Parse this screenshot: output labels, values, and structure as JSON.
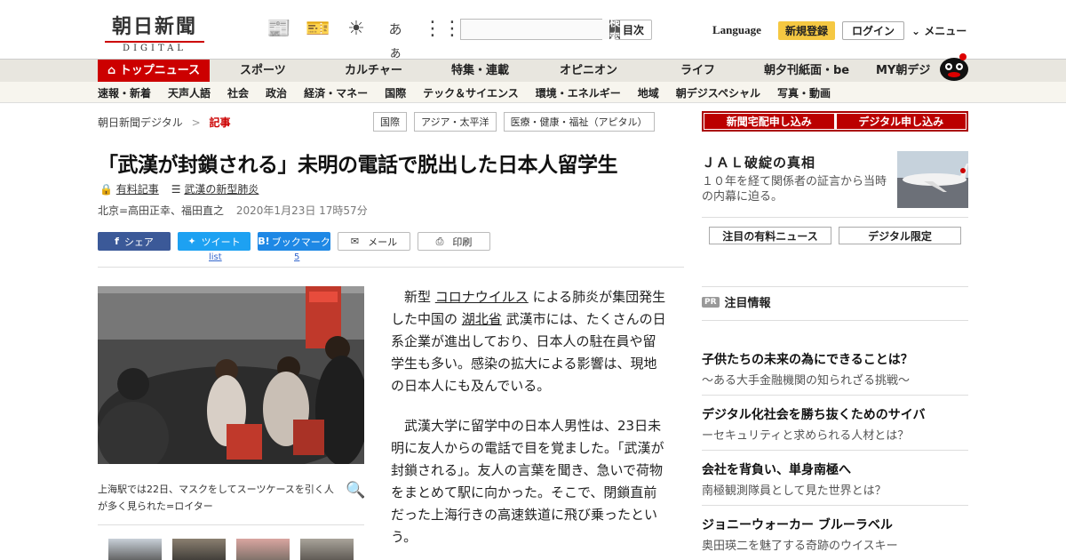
{
  "header": {
    "logo_jp": "朝日新聞",
    "logo_en": "DIGITAL",
    "search_button": "検索",
    "mokuji": "目次",
    "language": "Language",
    "register": "新規登録",
    "login": "ログイン",
    "menu": "メニュー"
  },
  "nav1": [
    "トップニュース",
    "スポーツ",
    "カルチャー",
    "特集・連載",
    "オピニオン",
    "ライフ",
    "朝夕刊紙面・be",
    "MY朝デジ"
  ],
  "nav2": [
    "速報・新着",
    "天声人語",
    "社会",
    "政治",
    "経済・マネー",
    "国際",
    "テック＆サイエンス",
    "環境・エネルギー",
    "地域",
    "朝デジスペシャル",
    "写真・動画"
  ],
  "breadcrumb": {
    "home": "朝日新聞デジタル",
    "sep": ">",
    "current": "記事"
  },
  "tags": [
    "国際",
    "アジア・太平洋",
    "医療・健康・福祉（アピタル）"
  ],
  "article": {
    "headline": "「武漢が封鎖される」未明の電話で脱出した日本人留学生",
    "paid_label": "有料記事",
    "series_label": "武漢の新型肺炎",
    "byline": "北京=高田正幸、福田直之",
    "datetime": "2020年1月23日 17時57分",
    "share": {
      "facebook": "シェア",
      "twitter": "ツイート",
      "hatena": "ブックマーク",
      "mail": "メール",
      "print": "印刷"
    },
    "twitter_count": "list",
    "hatena_count": "5",
    "caption": "上海駅では22日、マスクをしてスーツケースを引く人が多く見られた=ロイター",
    "p1_pre": "新型",
    "p1_kw1": "コロナウイルス",
    "p1_mid": "による肺炎が集団発生した中国の",
    "p1_kw2": "湖北省",
    "p1_post": "武漢市には、たくさんの日系企業が進出しており、日本人の駐在員や留学生も多い。感染の拡大による影響は、現地の日本人にも及んでいる。",
    "p2": "武漢大学に留学中の日本人男性は、23日未明に友人からの電話で目を覚ました。「武漢が封鎖される」。友人の言葉を聞き、急いで荷物をまとめて駅に向かった。そこで、閉鎖直前だった上海行きの高速鉄道に飛び乗ったという。"
  },
  "sidebar": {
    "btn_newspaper": "新聞宅配申し込み",
    "btn_digital": "デジタル申し込み",
    "jal_title": "ＪＡＬ破綻の真相",
    "jal_desc": "１０年を経て関係者の証言から当時の内幕に迫る。",
    "tab_news": "注目の有料ニュース",
    "tab_digital": "デジタル限定",
    "pr_badge": "PR",
    "pr_head": "注目情報",
    "pr_items": [
      {
        "title": "子供たちの未来の為にできることは？",
        "sub": "～ある大手金融機関の知られざる挑戦～"
      },
      {
        "title": "デジタル化社会を勝ち抜くためのサイバ",
        "sub": "ーセキュリティと求められる人材とは？"
      },
      {
        "title": "会社を背負い、単身南極へ",
        "sub": "南極観測隊員として見た世界とは？"
      },
      {
        "title": "ジョニーウォーカー ブルーラベル",
        "sub": "奥田瑛二を魅了する奇跡のウイスキー"
      }
    ]
  },
  "colors": {
    "accent": "#cc0000",
    "register_bg": "#f5c842"
  }
}
